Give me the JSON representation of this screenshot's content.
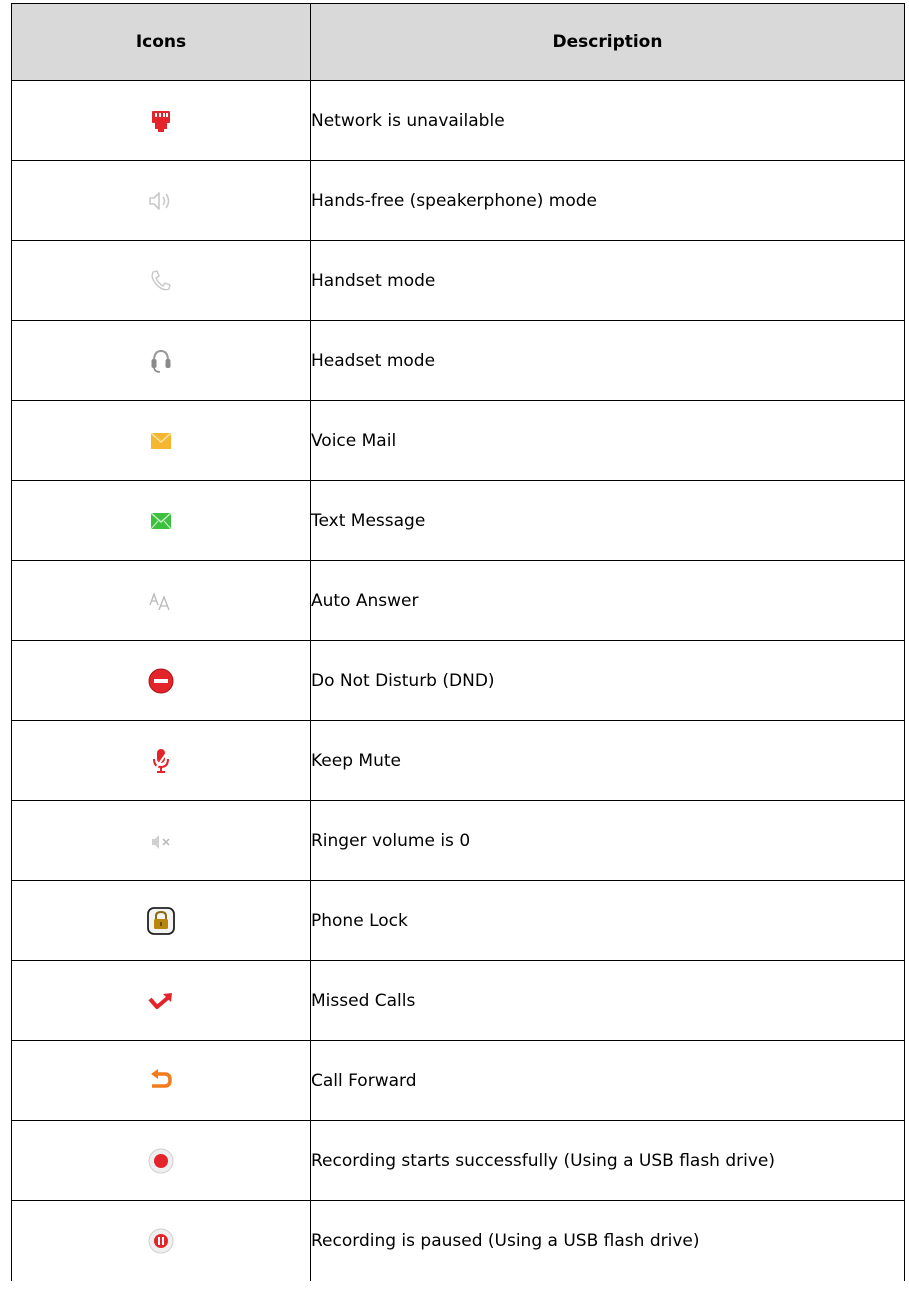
{
  "table": {
    "headers": {
      "icons": "Icons",
      "description": "Description"
    },
    "rows": [
      {
        "icon": "network-unavailable-icon",
        "description": "Network is unavailable"
      },
      {
        "icon": "speaker-icon",
        "description": "Hands-free (speakerphone) mode"
      },
      {
        "icon": "handset-icon",
        "description": "Handset mode"
      },
      {
        "icon": "headset-icon",
        "description": "Headset mode"
      },
      {
        "icon": "voice-mail-icon",
        "description": "Voice Mail"
      },
      {
        "icon": "text-message-icon",
        "description": "Text Message"
      },
      {
        "icon": "auto-answer-icon",
        "description": "Auto Answer"
      },
      {
        "icon": "dnd-icon",
        "description": "Do Not Disturb (DND)"
      },
      {
        "icon": "mute-icon",
        "description": "Keep Mute"
      },
      {
        "icon": "ringer-off-icon",
        "description": "Ringer volume is 0"
      },
      {
        "icon": "lock-icon",
        "description": "Phone Lock"
      },
      {
        "icon": "missed-call-icon",
        "description": "Missed Calls"
      },
      {
        "icon": "call-forward-icon",
        "description": "Call Forward"
      },
      {
        "icon": "record-icon",
        "description": "Recording starts successfully (Using a USB flash drive)"
      },
      {
        "icon": "record-pause-icon",
        "description": "Recording is paused (Using a USB flash drive)"
      }
    ]
  },
  "colors": {
    "header_bg": "#d9d9d9",
    "border": "#000000",
    "icon_red": "#e3242b",
    "icon_grey": "#c8c8c8",
    "mail_yellow": "#f5b731",
    "mail_green": "#3fbf3f",
    "forward_orange": "#f07c1c",
    "lock_gold": "#b8860b"
  }
}
